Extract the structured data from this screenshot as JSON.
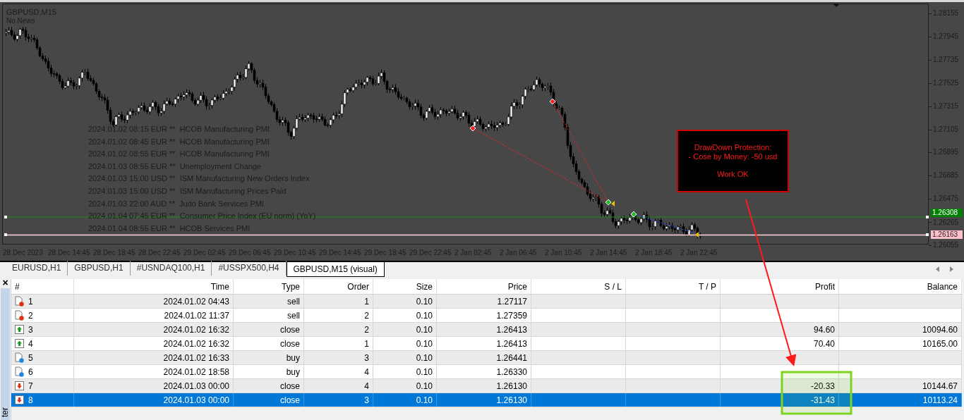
{
  "chart": {
    "symbol": "GBPUSD,M15",
    "news_status": "No News",
    "price_ticks": [
      "1.28155",
      "1.27945",
      "1.27735",
      "1.27525",
      "1.27315",
      "1.27105",
      "1.26895",
      "1.26685",
      "1.26475",
      "1.26265",
      "1.26055"
    ],
    "time_ticks": [
      "28 Dec 2023",
      "28 Dec 14:45",
      "28 Dec 18:45",
      "28 Dec 22:45",
      "29 Dec 02:45",
      "29 Dec 06:45",
      "29 Dec 10:45",
      "29 Dec 14:45",
      "29 Dec 18:45",
      "29 Dec 22:45",
      "2 Jan 02:45",
      "2 Jan 06:45",
      "2 Jan 10:45",
      "2 Jan 14:45",
      "2 Jan 18:45",
      "2 Jan 22:45"
    ],
    "line_labels": [
      {
        "text": "1.26308",
        "color": "#008000"
      },
      {
        "text": "1.26163",
        "color": "#ffc0cb"
      }
    ],
    "news": [
      "2024.01.02 08:15 EUR **  HCOB Manufacturing PMI",
      "2024.01.02 08:45 EUR **  HCOB Manufacturing PMI",
      "2024.01.02 08:55 EUR **  HCOB Manufacturing PMI",
      "2024.01.03 08:55 EUR **  Unemployment Change",
      "2024.01.03 15:00 USD **  ISM Manufacturing New Orders Index",
      "2024.01.03 15:00 USD **  ISM Manufacturing Prices Paid",
      "2024.01.03 22:00 AUD **  Judo Bank Services PMI",
      "2024.01.04 07:45 EUR **  Consumer Price Index (EU norm) (YoY)",
      "2024.01.04 08:55 EUR **  HCOB Services PMI"
    ],
    "alert": {
      "title": "DrawDown Protection:",
      "detail": "- Cose by Money: -50 usd",
      "status": "Work OK"
    }
  },
  "tabs": [
    {
      "label": "EURUSD,H1",
      "selected": false
    },
    {
      "label": "GBPUSD,H1",
      "selected": false
    },
    {
      "label": "#USNDAQ100,H1",
      "selected": false
    },
    {
      "label": "#USSPX500,H4",
      "selected": false
    },
    {
      "label": "GBPUSD,M15 (visual)",
      "selected": true
    }
  ],
  "panel": {
    "close": "×",
    "side_label": "ter"
  },
  "table": {
    "columns": [
      "#",
      "Time",
      "Type",
      "Order",
      "Size",
      "Price",
      "S / L",
      "T / P",
      "Profit",
      "Balance"
    ],
    "rows": [
      {
        "kind": "sell",
        "selected": false,
        "cells": [
          "1",
          "2024.01.02 04:43",
          "sell",
          "1",
          "0.10",
          "1.27117",
          "",
          "",
          "",
          ""
        ]
      },
      {
        "kind": "sell",
        "selected": false,
        "cells": [
          "2",
          "2024.01.02 11:37",
          "sell",
          "2",
          "0.10",
          "1.27359",
          "",
          "",
          "",
          ""
        ]
      },
      {
        "kind": "gain",
        "selected": false,
        "cells": [
          "3",
          "2024.01.02 16:32",
          "close",
          "2",
          "0.10",
          "1.26413",
          "",
          "",
          "94.60",
          "10094.60"
        ]
      },
      {
        "kind": "gain",
        "selected": false,
        "cells": [
          "4",
          "2024.01.02 16:32",
          "close",
          "1",
          "0.10",
          "1.26413",
          "",
          "",
          "70.40",
          "10165.00"
        ]
      },
      {
        "kind": "buy",
        "selected": false,
        "cells": [
          "5",
          "2024.01.02 16:33",
          "buy",
          "3",
          "0.10",
          "1.26441",
          "",
          "",
          "",
          ""
        ]
      },
      {
        "kind": "buy",
        "selected": false,
        "cells": [
          "6",
          "2024.01.02 18:58",
          "buy",
          "4",
          "0.10",
          "1.26330",
          "",
          "",
          "",
          ""
        ]
      },
      {
        "kind": "loss",
        "selected": false,
        "cells": [
          "7",
          "2024.01.03 00:00",
          "close",
          "4",
          "0.10",
          "1.26130",
          "",
          "",
          "-20.33",
          "10144.67"
        ]
      },
      {
        "kind": "loss",
        "selected": true,
        "cells": [
          "8",
          "2024.01.03 00:00",
          "close",
          "3",
          "0.10",
          "1.26130",
          "",
          "",
          "-31.43",
          "10113.24"
        ]
      }
    ]
  }
}
